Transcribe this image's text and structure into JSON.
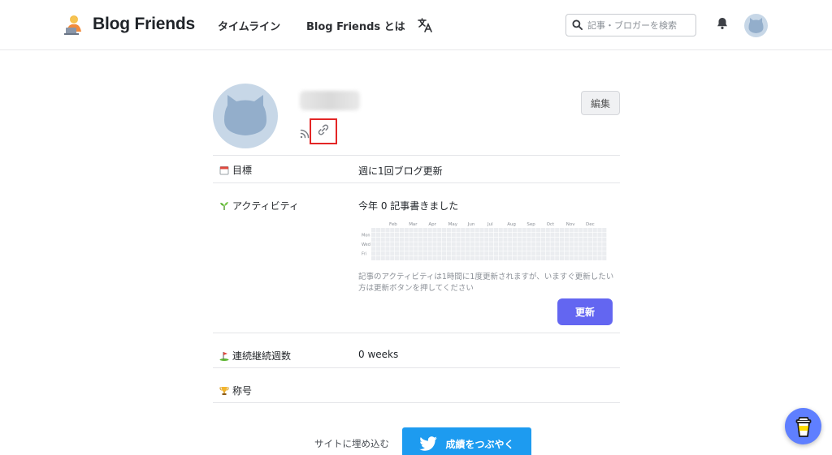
{
  "header": {
    "logo_text": "Blog Friends",
    "nav": [
      {
        "label": "タイムライン"
      },
      {
        "label": "Blog Friends とは"
      }
    ],
    "search_placeholder": "記事・ブロガーを検索",
    "icons": {
      "logo": "person-laptop-icon",
      "translate": "translate-icon",
      "search": "search-icon",
      "bell": "bell-icon",
      "avatar": "cat-avatar-icon"
    }
  },
  "profile": {
    "edit_label": "編集",
    "icons": {
      "rss": "rss-icon",
      "link": "link-icon",
      "avatar": "cat-avatar-icon"
    }
  },
  "rows": {
    "goal": {
      "label": "目標",
      "value": "週に1回ブログ更新",
      "icon": "calendar-icon"
    },
    "activity": {
      "label": "アクティビティ",
      "value": "今年 0 記事書きました",
      "icon": "seedling-icon",
      "months": [
        "Feb",
        "Mar",
        "Apr",
        "May",
        "Jun",
        "Jul",
        "Aug",
        "Sep",
        "Oct",
        "Nov",
        "Dec"
      ],
      "days": [
        "Mon",
        "Wed",
        "Fri"
      ],
      "note": "記事のアクティビティは1時間に1度更新されますが、いますぐ更新したい方は更新ボタンを押してください",
      "update_label": "更新"
    },
    "streak": {
      "label": "連続継続週数",
      "value": "0 weeks",
      "icon": "golf-flag-icon"
    },
    "title": {
      "label": "称号",
      "value": "",
      "icon": "trophy-icon"
    }
  },
  "footer": {
    "embed_label": "サイトに埋め込む",
    "tweet_label": "成績をつぶやく",
    "icons": {
      "tweet": "twitter-bird-icon",
      "coffee": "coffee-cup-icon"
    }
  },
  "colors": {
    "accent": "#6366f1",
    "twitter": "#1d9bf0",
    "highlight": "#e32626"
  }
}
